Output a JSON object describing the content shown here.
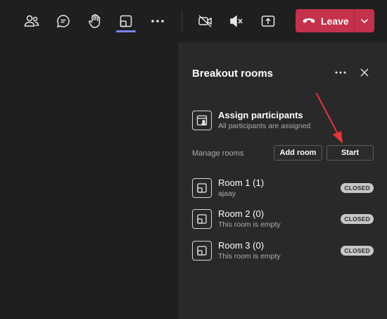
{
  "toolbar": {
    "leave_label": "Leave"
  },
  "panel": {
    "title": "Breakout rooms",
    "assign_title": "Assign participants",
    "assign_subtitle": "All participants are assigned",
    "manage_label": "Manage rooms",
    "add_room_label": "Add room",
    "start_label": "Start",
    "rooms": [
      {
        "title": "Room 1 (1)",
        "subtitle": "ajaay",
        "status": "CLOSED"
      },
      {
        "title": "Room 2 (0)",
        "subtitle": "This room is empty",
        "status": "CLOSED"
      },
      {
        "title": "Room 3 (0)",
        "subtitle": "This room is empty",
        "status": "CLOSED"
      }
    ]
  },
  "icons": {
    "toolbar": [
      "people-icon",
      "chat-icon",
      "raise-hand-icon",
      "breakout-rooms-icon",
      "more-icon",
      "camera-off-icon",
      "mic-muted-icon",
      "share-icon"
    ],
    "panel": [
      "more-icon",
      "close-icon",
      "assign-icon",
      "room-icon"
    ]
  },
  "colors": {
    "leave": "#c4314b",
    "accent": "#7b83eb",
    "arrow": "#e8343a",
    "panel": "#292929",
    "background": "#1f1f1f"
  }
}
